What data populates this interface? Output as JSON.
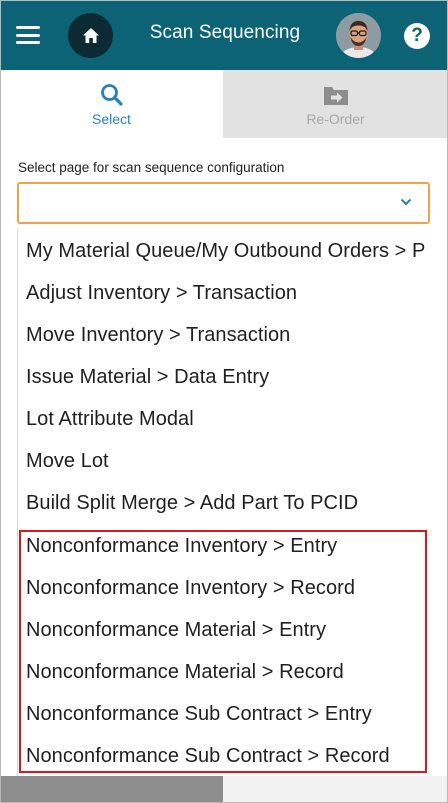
{
  "header": {
    "title": "Scan Sequencing",
    "help_label": "?",
    "bg_color": "#0c6375"
  },
  "icons": {
    "menu": "hamburger-icon",
    "home": "home-icon",
    "avatar": "user-avatar",
    "help": "help-icon",
    "select_tab": "search-icon",
    "reorder_tab": "folder-arrow-icon",
    "dropdown": "chevron-down-icon"
  },
  "tabs": [
    {
      "label": "Select",
      "active": true
    },
    {
      "label": "Re-Order",
      "active": false
    }
  ],
  "form": {
    "label": "Select page for scan sequence configuration",
    "selected_value": "",
    "focus_color": "#f0a24a"
  },
  "dropdown": {
    "options": [
      "My Material Queue/My Outbound Orders > P",
      "Adjust Inventory > Transaction",
      "Move Inventory > Transaction",
      "Issue Material > Data Entry",
      "Lot Attribute Modal",
      "Move Lot",
      "Build Split Merge > Add Part To PCID",
      "Nonconformance Inventory > Entry",
      "Nonconformance Inventory > Record",
      "Nonconformance Material > Entry",
      "Nonconformance Material > Record",
      "Nonconformance Sub Contract > Entry",
      "Nonconformance Sub Contract > Record"
    ],
    "highlight_color": "#d7191c"
  }
}
